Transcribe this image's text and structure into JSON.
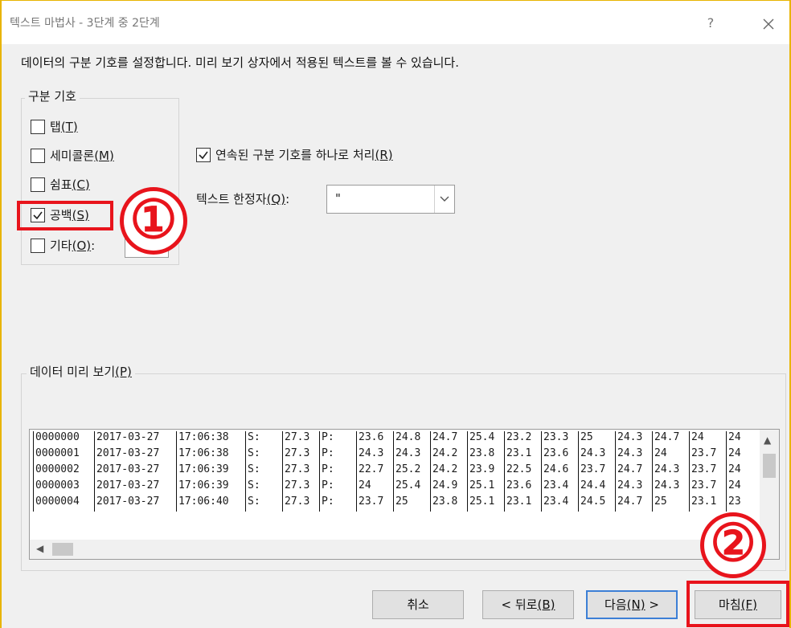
{
  "window": {
    "title": "텍스트 마법사 - 3단계 중 2단계",
    "help": "?",
    "close": "×"
  },
  "description": "데이터의 구분 기호를 설정합니다. 미리 보기 상자에서 적용된 텍스트를 볼 수 있습니다.",
  "delimiters": {
    "legend": "구분 기호",
    "items": [
      {
        "label": "탭",
        "key": "(T)",
        "checked": false
      },
      {
        "label": "세미콜론",
        "key": "(M)",
        "checked": false
      },
      {
        "label": "쉼표",
        "key": "(C)",
        "checked": false
      },
      {
        "label": "공백",
        "key": "(S)",
        "checked": true
      },
      {
        "label": "기타",
        "key": "(O)",
        "suffix": ":",
        "checked": false
      }
    ]
  },
  "consecutive": {
    "label": "연속된 구분 기호를 하나로 처리",
    "key": "(R)",
    "checked": true
  },
  "qualifier": {
    "label": "텍스트 한정자",
    "key": "(Q)",
    "suffix": ":",
    "value": "\""
  },
  "preview": {
    "legend": "데이터 미리 보기",
    "key": "(P)",
    "rows": [
      [
        "0000000",
        "2017-03-27",
        "17:06:38",
        "S:",
        "27.3",
        "P:",
        "23.6",
        "24.8",
        "24.7",
        "25.4",
        "23.2",
        "23.3",
        "25",
        "24.3",
        "24.7",
        "24",
        "24"
      ],
      [
        "0000001",
        "2017-03-27",
        "17:06:38",
        "S:",
        "27.3",
        "P:",
        "24.3",
        "24.3",
        "24.2",
        "23.8",
        "23.1",
        "23.6",
        "24.3",
        "24.3",
        "24",
        "23.7",
        "24"
      ],
      [
        "0000002",
        "2017-03-27",
        "17:06:39",
        "S:",
        "27.3",
        "P:",
        "22.7",
        "25.2",
        "24.2",
        "23.9",
        "22.5",
        "24.6",
        "23.7",
        "24.7",
        "24.3",
        "23.7",
        "24"
      ],
      [
        "0000003",
        "2017-03-27",
        "17:06:39",
        "S:",
        "27.3",
        "P:",
        "24",
        "25.4",
        "24.9",
        "25.1",
        "23.6",
        "23.4",
        "24.4",
        "24.3",
        "24.3",
        "23.7",
        "24"
      ],
      [
        "0000004",
        "2017-03-27",
        "17:06:40",
        "S:",
        "27.3",
        "P:",
        "23.7",
        "25",
        "23.8",
        "25.1",
        "23.1",
        "23.4",
        "24.5",
        "24.7",
        "25",
        "23.1",
        "23"
      ]
    ]
  },
  "buttons": {
    "cancel": "취소",
    "back": "< 뒤로",
    "back_key": "(B)",
    "next": "다음",
    "next_key": "(N)",
    "next_suffix": " >",
    "finish": "마침",
    "finish_key": "(F)"
  },
  "annotations": {
    "step1": "①",
    "step2": "②",
    "color": "#e8141c"
  }
}
